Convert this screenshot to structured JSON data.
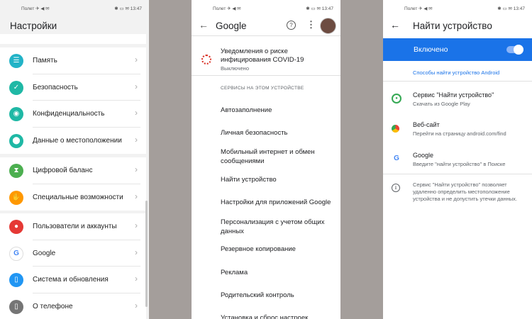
{
  "statusbar": {
    "left": "Полет ✈ ◀ ✉",
    "right": "✱ ▭ ✉ 13:47"
  },
  "screen1": {
    "title": "Настройки",
    "groups": [
      [
        {
          "label": "Память",
          "color": "#22b3c7"
        },
        {
          "label": "Безопасность",
          "color": "#1fb8a5"
        },
        {
          "label": "Конфиденциальность",
          "color": "#1fb8a5"
        },
        {
          "label": "Данные о местоположении",
          "color": "#1fb8a5"
        }
      ],
      [
        {
          "label": "Цифровой баланс",
          "color": "#4caf50"
        },
        {
          "label": "Специальные возможности",
          "color": "#ff9800"
        }
      ],
      [
        {
          "label": "Пользователи и аккаунты",
          "color": "#e53935"
        },
        {
          "label": "Google",
          "color": "#ffffff"
        },
        {
          "label": "Система и обновления",
          "color": "#2196f3"
        },
        {
          "label": "О телефоне",
          "color": "#757575"
        }
      ]
    ]
  },
  "screen2": {
    "title": "Google",
    "covid": {
      "title": "Уведомления о риске инфицирования COVID-19",
      "sub": "Выключено"
    },
    "section": "СЕРВИСЫ НА ЭТОМ УСТРОЙСТВЕ",
    "items": [
      "Автозаполнение",
      "Личная безопасность",
      "Мобильный интернет и обмен сообщениями",
      "Найти устройство",
      "Настройки для приложений Google",
      "Персонализация с учетом общих данных",
      "Резервное копирование",
      "Реклама",
      "Родительский контроль",
      "Установка и сброс настроек"
    ]
  },
  "screen3": {
    "title": "Найти устройство",
    "enabled": "Включено",
    "link": "Способы найти устройство Android",
    "options": [
      {
        "title": "Сервис \"Найти устройство\"",
        "sub": "Скачать из Google Play"
      },
      {
        "title": "Веб-сайт",
        "sub": "Перейти на страницу android.com/find"
      },
      {
        "title": "Google",
        "sub": "Введите \"найти устройство\" в Поиске"
      }
    ],
    "info": "Сервис \"Найти устройство\" позволяет удаленно определить местоположение устройства и не допустить утечки данных."
  }
}
